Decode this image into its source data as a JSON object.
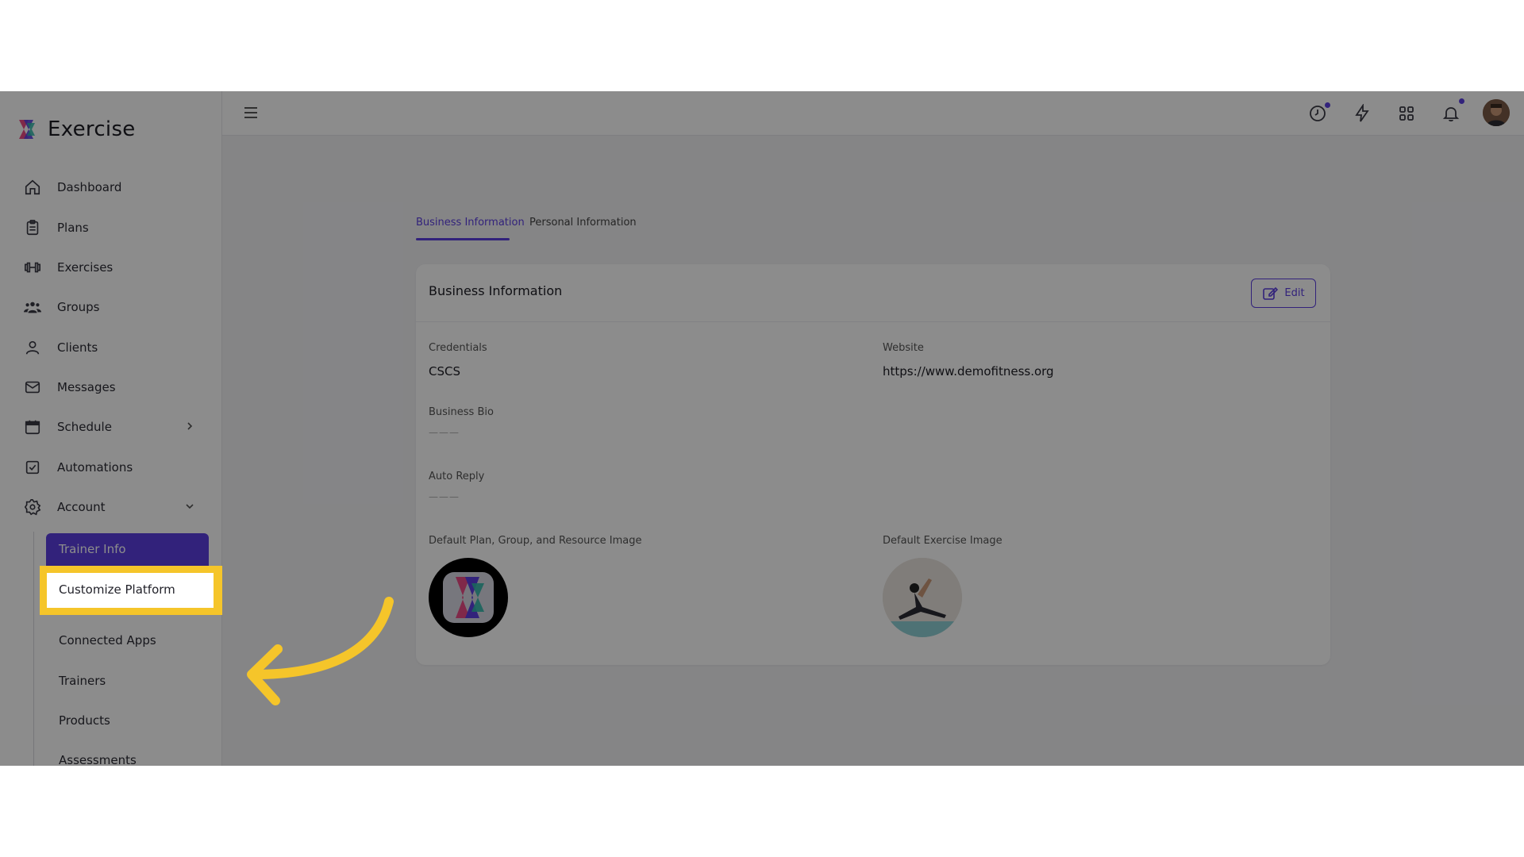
{
  "app": {
    "name": "Exercise"
  },
  "sidebar": {
    "items": [
      {
        "label": "Dashboard",
        "icon": "home-icon"
      },
      {
        "label": "Plans",
        "icon": "clipboard-icon"
      },
      {
        "label": "Exercises",
        "icon": "dumbbell-icon"
      },
      {
        "label": "Groups",
        "icon": "users-icon"
      },
      {
        "label": "Clients",
        "icon": "user-icon"
      },
      {
        "label": "Messages",
        "icon": "mail-icon"
      },
      {
        "label": "Schedule",
        "icon": "calendar-icon"
      },
      {
        "label": "Automations",
        "icon": "checkbox-icon"
      },
      {
        "label": "Account",
        "icon": "gear-icon"
      }
    ],
    "sub_items": [
      {
        "label": "Trainer Info"
      },
      {
        "label": "Customize Platform"
      },
      {
        "label": "Connected Apps"
      },
      {
        "label": "Trainers"
      },
      {
        "label": "Products"
      },
      {
        "label": "Assessments"
      }
    ]
  },
  "topbar": {
    "icons": [
      "clock-icon",
      "bolt-icon",
      "grid-icon",
      "bell-icon"
    ]
  },
  "tabs": [
    {
      "label": "Business Information",
      "active": true
    },
    {
      "label": "Personal Information",
      "active": false
    }
  ],
  "card": {
    "title": "Business Information",
    "edit_label": "Edit",
    "credentials_label": "Credentials",
    "credentials_value": "CSCS",
    "website_label": "Website",
    "website_value": "https://www.demofitness.org",
    "bio_label": "Business Bio",
    "bio_value": "———",
    "auto_reply_label": "Auto Reply",
    "auto_reply_value": "———",
    "default_plan_image_label": "Default Plan, Group, and Resource Image",
    "default_exercise_image_label": "Default Exercise Image"
  },
  "colors": {
    "accent": "#5b3fe0",
    "highlight": "#f5c52a"
  }
}
